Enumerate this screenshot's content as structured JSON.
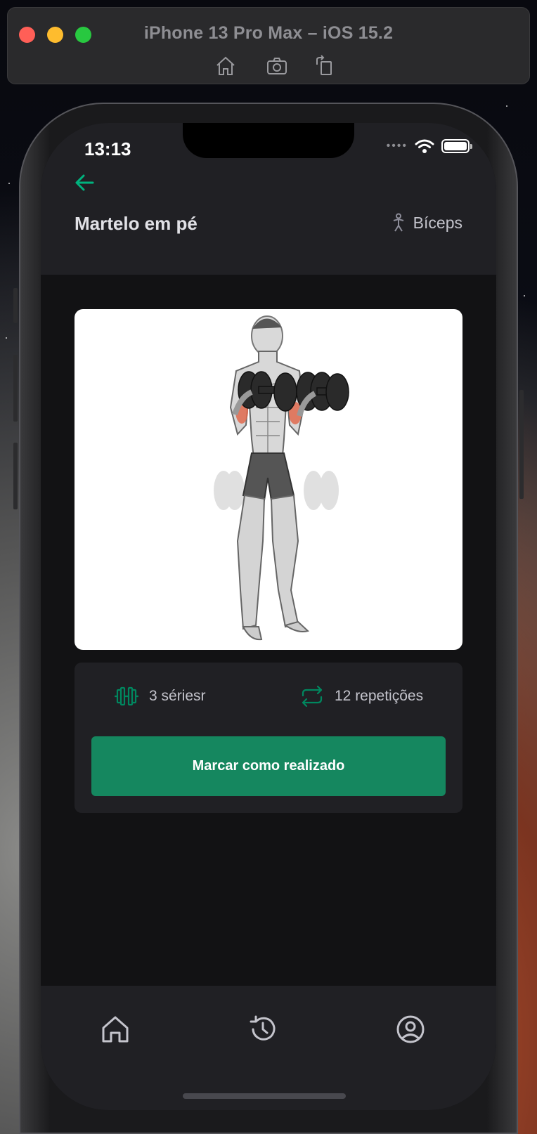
{
  "simulator": {
    "title": "iPhone 13 Pro Max – iOS 15.2",
    "tools": [
      "home-icon",
      "screenshot-icon",
      "rotate-icon"
    ]
  },
  "status_bar": {
    "time": "13:13",
    "icons": [
      "signal-dots-icon",
      "wifi-icon",
      "battery-icon"
    ]
  },
  "header": {
    "back_icon": "arrow-left-icon",
    "title": "Martelo em pé",
    "group_icon": "body-icon",
    "group": "Bíceps"
  },
  "exercise": {
    "image_alt": "hammer curl illustration",
    "series_icon": "dumbbell-icon",
    "series": "3 sériesr",
    "repetitions_icon": "repeat-icon",
    "repetitions": "12 repetições",
    "done_button": "Marcar como realizado"
  },
  "tabbar": {
    "items": [
      {
        "icon": "home-icon"
      },
      {
        "icon": "history-icon"
      },
      {
        "icon": "profile-icon"
      }
    ]
  },
  "colors": {
    "accent": "#00b37e",
    "button": "#15875f",
    "background": "#121214",
    "surface": "#202024"
  }
}
